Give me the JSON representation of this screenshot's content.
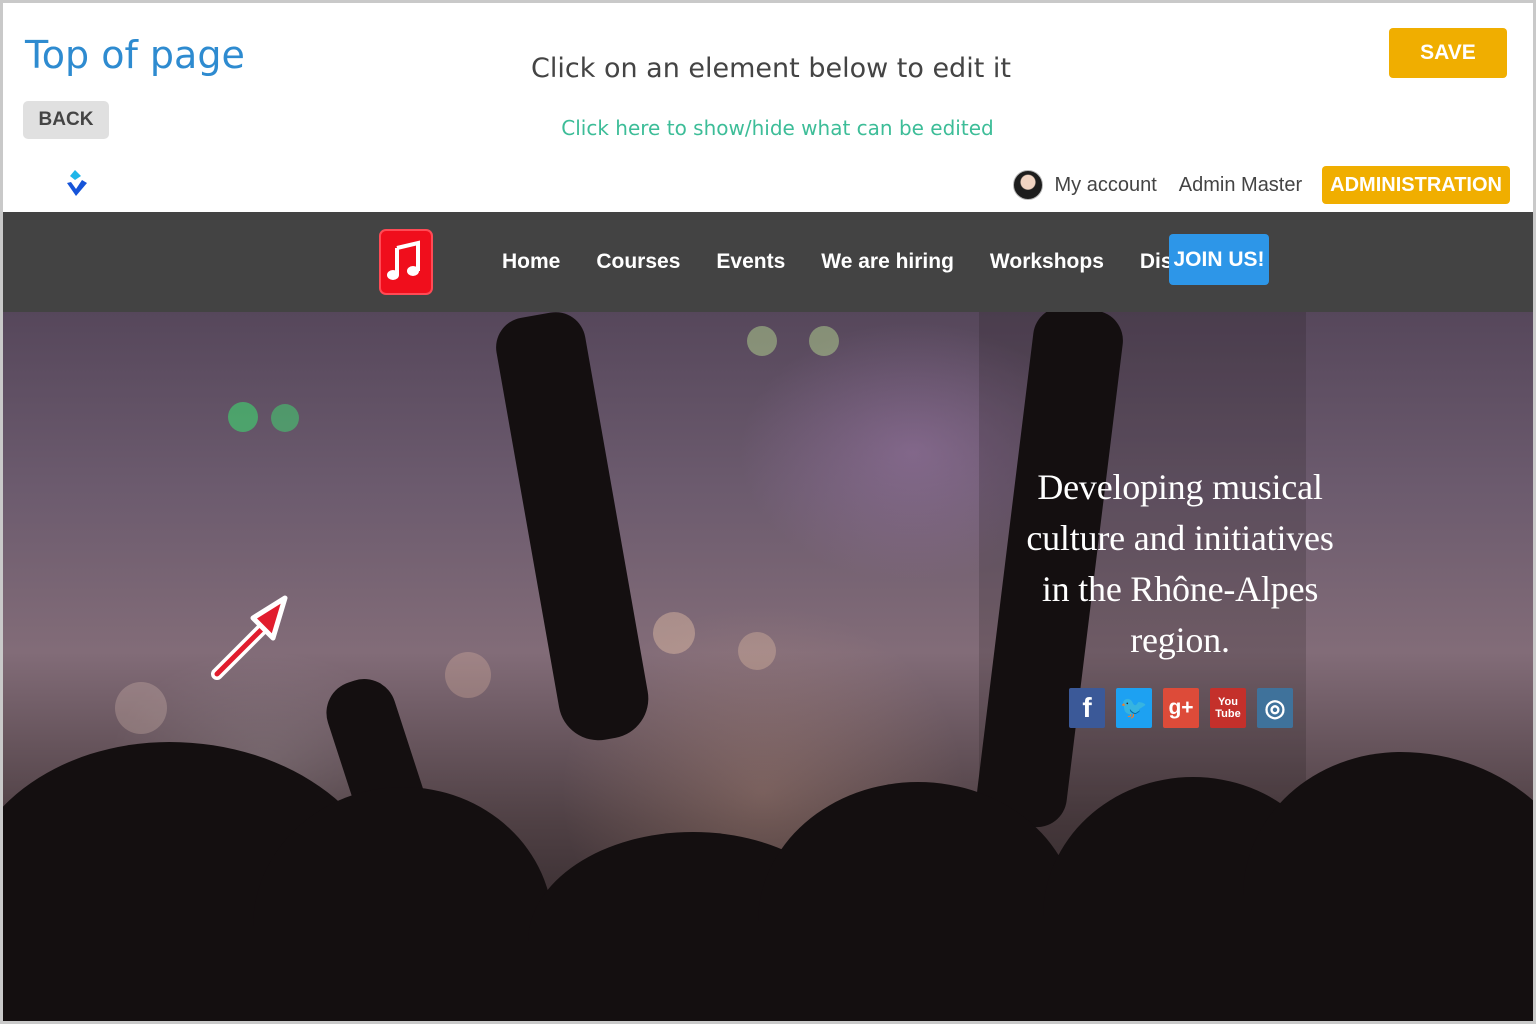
{
  "editor": {
    "title": "Top of page",
    "back_label": "BACK",
    "instruction": "Click on an element below to edit it",
    "toggle_link": "Click here to show/hide what can be edited",
    "save_label": "SAVE"
  },
  "account": {
    "my_account": "My account",
    "admin_name": "Admin Master",
    "administration_label": "ADMINISTRATION"
  },
  "nav": {
    "items": [
      "Home",
      "Courses",
      "Events",
      "We are hiring",
      "Workshops",
      "Discover"
    ],
    "join_label": "JOIN US!"
  },
  "hero": {
    "tagline": "Developing musical culture and initiatives in the Rhône-Alpes region.",
    "social": [
      {
        "name": "facebook",
        "icon": "facebook-icon",
        "glyph": "f",
        "color": "#3b5998"
      },
      {
        "name": "twitter",
        "icon": "twitter-icon",
        "glyph": "🐦",
        "color": "#1da1f2"
      },
      {
        "name": "google-plus",
        "icon": "google-plus-icon",
        "glyph": "g+",
        "color": "#dd4b39"
      },
      {
        "name": "youtube",
        "icon": "youtube-icon",
        "glyph": "You Tube",
        "color": "#c4302b"
      },
      {
        "name": "instagram",
        "icon": "instagram-icon",
        "glyph": "◎",
        "color": "#3f729b"
      }
    ]
  },
  "colors": {
    "title_blue": "#2e8bd0",
    "link_green": "#3dbd98",
    "button_orange": "#f0ae00",
    "join_blue": "#2d96e8",
    "nav_gray": "#434343",
    "logo_red": "#f00e1c"
  }
}
